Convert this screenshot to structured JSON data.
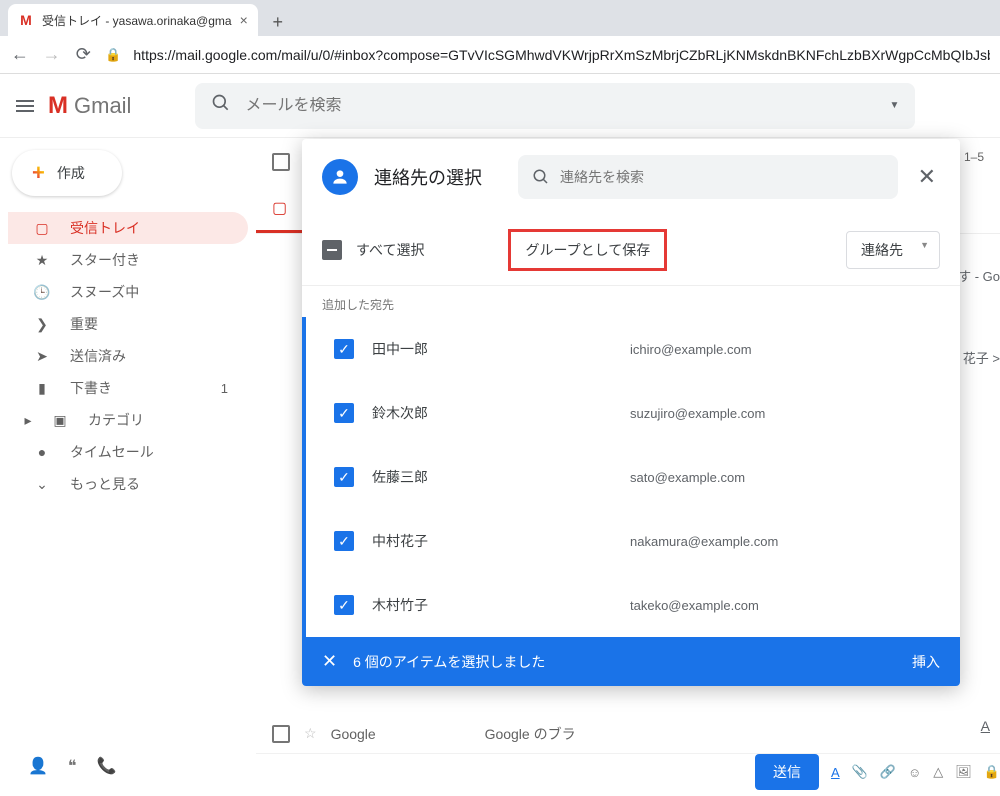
{
  "browser": {
    "tab_title": "受信トレイ - yasawa.orinaka@gma",
    "url": "https://mail.google.com/mail/u/0/#inbox?compose=GTvVIcSGMhwdVKWrjpRrXmSzMbrjCZbRLjKNMskdnBKNFchLzbBXrWgpCcMbQIbJsbc"
  },
  "header": {
    "brand": "Gmail",
    "search_placeholder": "メールを検索"
  },
  "sidebar": {
    "compose": "作成",
    "items": [
      {
        "label": "受信トレイ",
        "icon": "inbox",
        "active": true
      },
      {
        "label": "スター付き",
        "icon": "star"
      },
      {
        "label": "スヌーズ中",
        "icon": "clock"
      },
      {
        "label": "重要",
        "icon": "important"
      },
      {
        "label": "送信済み",
        "icon": "sent"
      },
      {
        "label": "下書き",
        "icon": "draft",
        "count": "1"
      },
      {
        "label": "カテゴリ",
        "icon": "category",
        "expandable": true
      },
      {
        "label": "タイムセール",
        "icon": "tag"
      },
      {
        "label": "もっと見る",
        "icon": "more"
      }
    ]
  },
  "content": {
    "range": "1–5",
    "snip1": "す - Go",
    "snip2": "花子 >",
    "rows": [
      {
        "sender": "Google",
        "subject": "Google のブラ"
      }
    ]
  },
  "dialog": {
    "title": "連絡先の選択",
    "search_placeholder": "連絡先を検索",
    "select_all": "すべて選択",
    "save_group": "グループとして保存",
    "dropdown": "連絡先",
    "added_label": "追加した宛先",
    "contacts": [
      {
        "name": "田中一郎",
        "email": "ichiro@example.com"
      },
      {
        "name": "鈴木次郎",
        "email": "suzujiro@example.com"
      },
      {
        "name": "佐藤三郎",
        "email": "sato@example.com"
      },
      {
        "name": "中村花子",
        "email": "nakamura@example.com"
      },
      {
        "name": "木村竹子",
        "email": "takeko@example.com"
      }
    ],
    "footer_msg": "6 個のアイテムを選択しました",
    "insert": "挿入"
  },
  "compose_bar": {
    "send": "送信",
    "a": "A"
  }
}
